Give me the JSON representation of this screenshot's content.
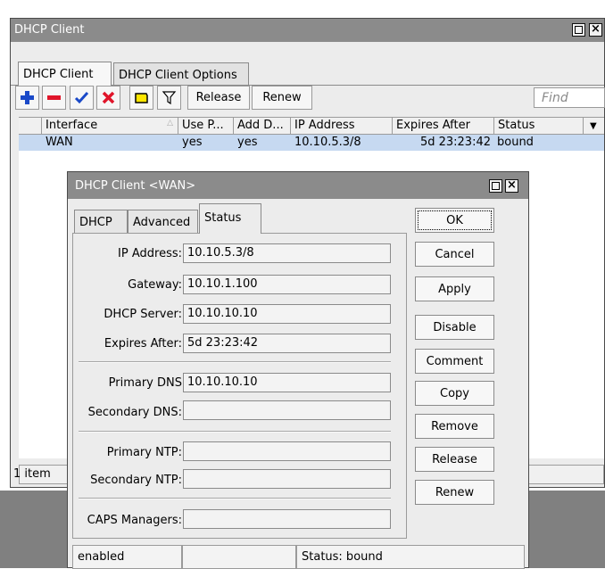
{
  "window": {
    "title": "DHCP Client",
    "tabs": [
      "DHCP Client",
      "DHCP Client Options"
    ],
    "toolbar": {
      "release_label": "Release",
      "renew_label": "Renew",
      "find_placeholder": "Find"
    },
    "table": {
      "columns": [
        "Interface",
        "Use P...",
        "Add D...",
        "IP Address",
        "Expires After",
        "Status"
      ],
      "rows": [
        {
          "interface": "WAN",
          "use_peer": "yes",
          "add_default": "yes",
          "ip_address": "10.10.5.3/8",
          "expires_after": "5d 23:23:42",
          "status": "bound"
        }
      ]
    },
    "status_text": "1 item"
  },
  "dialog": {
    "title": "DHCP Client <WAN>",
    "tabs": [
      "DHCP",
      "Advanced",
      "Status"
    ],
    "active_tab": "Status",
    "fields": {
      "ip_address": {
        "label": "IP Address:",
        "value": "10.10.5.3/8"
      },
      "gateway": {
        "label": "Gateway:",
        "value": "10.10.1.100"
      },
      "dhcp_server": {
        "label": "DHCP Server:",
        "value": "10.10.10.10"
      },
      "expires_after": {
        "label": "Expires After:",
        "value": "5d 23:23:42"
      },
      "primary_dns": {
        "label": "Primary DNS",
        "value": "10.10.10.10"
      },
      "secondary_dns": {
        "label": "Secondary DNS:",
        "value": ""
      },
      "primary_ntp": {
        "label": "Primary NTP:",
        "value": ""
      },
      "secondary_ntp": {
        "label": "Secondary NTP:",
        "value": ""
      },
      "caps_managers": {
        "label": "CAPS Managers:",
        "value": ""
      }
    },
    "buttons": {
      "ok": "OK",
      "cancel": "Cancel",
      "apply": "Apply",
      "disable": "Disable",
      "comment": "Comment",
      "copy": "Copy",
      "remove": "Remove",
      "release": "Release",
      "renew": "Renew"
    },
    "status_bar": {
      "state": "enabled",
      "middle": "",
      "status": "Status: bound"
    }
  },
  "colors": {
    "titlebar": "#8b8b8b",
    "selected_row": "#c6d9f1",
    "add_icon": "#1a49c8",
    "remove_icon": "#e0152a",
    "enable_icon": "#1a49c8",
    "disable_icon": "#e0152a",
    "comment_icon": "#ffe600"
  },
  "icons": [
    "add-icon",
    "remove-icon",
    "enable-check-icon",
    "disable-x-icon",
    "comment-icon",
    "filter-icon",
    "column-menu-arrow-icon",
    "maximize-icon",
    "close-icon"
  ]
}
